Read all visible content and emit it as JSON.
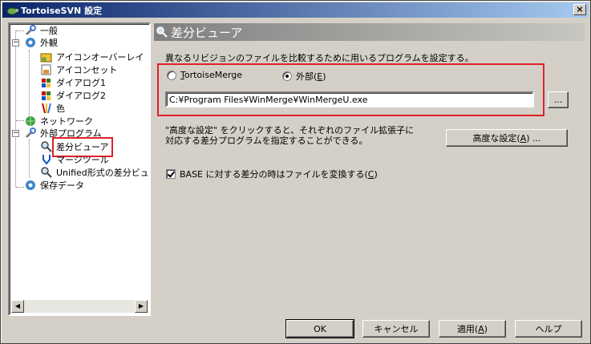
{
  "window": {
    "title": "TortoiseSVN 設定",
    "close_glyph": "×"
  },
  "tree": {
    "items": [
      {
        "label": "一般",
        "icon": "wrench-icon"
      },
      {
        "label": "外観",
        "icon": "gear-icon",
        "expander": "−"
      },
      {
        "label": "アイコンオーバーレイ",
        "icon": "overlay-icon"
      },
      {
        "label": "アイコンセット",
        "icon": "iconset-icon"
      },
      {
        "label": "ダイアログ1",
        "icon": "windows-flag-icon"
      },
      {
        "label": "ダイアログ2",
        "icon": "windows-flag-icon"
      },
      {
        "label": "色",
        "icon": "palette-icon"
      },
      {
        "label": "ネットワーク",
        "icon": "globe-icon"
      },
      {
        "label": "外部プログラム",
        "icon": "tools-icon",
        "expander": "−"
      },
      {
        "label": "差分ビューア",
        "icon": "magnifier-icon",
        "selected": true
      },
      {
        "label": "マージツール",
        "icon": "merge-icon"
      },
      {
        "label": "Unified形式の差分ビュ",
        "icon": "magnifier-icon"
      },
      {
        "label": "保存データ",
        "icon": "gear-icon"
      }
    ],
    "scroll_left": "◀",
    "scroll_right": "▶"
  },
  "panel": {
    "title": "差分ビューア",
    "description": "異なるリビジョンのファイルを比較するために用いるプログラムを設定する。",
    "radio_tortoise": {
      "label_underlined": "T",
      "label_rest": "ortoiseMerge",
      "checked": false
    },
    "radio_external": {
      "label_pre": "外部(",
      "label_underlined": "E",
      "label_post": ")",
      "checked": true
    },
    "path_value": "C:¥Program Files¥WinMerge¥WinMergeU.exe",
    "browse_label": "...",
    "note_line1": "\"高度な設定\" をクリックすると、それぞれのファイル拡張子に",
    "note_line2": "対応する差分プログラムを指定することができる。",
    "advanced_btn": {
      "pre": "高度な設定(",
      "underlined": "A",
      "post": ") ..."
    },
    "convert_checkbox": {
      "pre": "BASE に対する差分の時はファイルを変換する(",
      "underlined": "C",
      "post": ")",
      "checked": true
    }
  },
  "footer": {
    "ok": "OK",
    "cancel": "キャンセル",
    "apply": {
      "pre": "適用(",
      "underlined": "A",
      "post": ")"
    },
    "help": "ヘルプ"
  },
  "colors": {
    "highlight_red": "#e0202a",
    "titlebar_start": "#0a246a",
    "titlebar_end": "#a6caf0"
  }
}
